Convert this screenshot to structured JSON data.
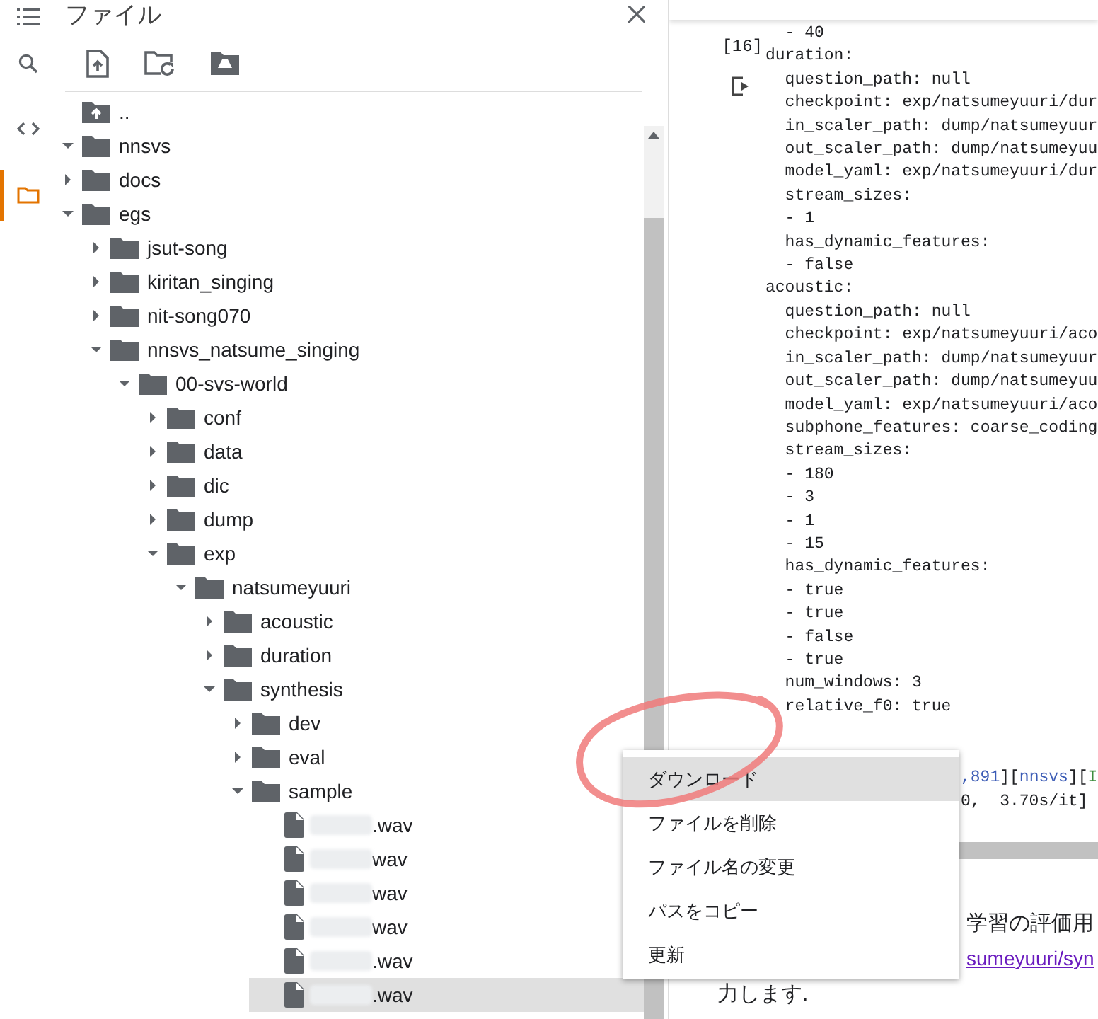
{
  "rail": [
    {
      "kind": "menu",
      "selected": false
    },
    {
      "kind": "search",
      "selected": false
    },
    {
      "kind": "code",
      "selected": false
    },
    {
      "kind": "folder",
      "selected": true
    }
  ],
  "panel": {
    "title": "ファイル",
    "toolbar": [
      {
        "kind": "upload"
      },
      {
        "kind": "refresh"
      },
      {
        "kind": "drive"
      }
    ]
  },
  "tree": [
    {
      "kind": "up",
      "name": "..",
      "selected": false
    },
    {
      "kind": "folder",
      "name": "nnsvs",
      "expanded": true,
      "selected": false,
      "children": [
        {
          "kind": "folder",
          "name": "docs",
          "expanded": false,
          "selected": false
        },
        {
          "kind": "folder",
          "name": "egs",
          "expanded": true,
          "selected": false,
          "children": [
            {
              "kind": "folder",
              "name": "jsut-song",
              "expanded": false,
              "selected": false
            },
            {
              "kind": "folder",
              "name": "kiritan_singing",
              "expanded": false,
              "selected": false
            },
            {
              "kind": "folder",
              "name": "nit-song070",
              "expanded": false,
              "selected": false
            },
            {
              "kind": "folder",
              "name": "nnsvs_natsume_singing",
              "expanded": true,
              "selected": false,
              "children": [
                {
                  "kind": "folder",
                  "name": "00-svs-world",
                  "expanded": true,
                  "selected": false,
                  "children": [
                    {
                      "kind": "folder",
                      "name": "conf",
                      "expanded": false,
                      "selected": false
                    },
                    {
                      "kind": "folder",
                      "name": "data",
                      "expanded": false,
                      "selected": false
                    },
                    {
                      "kind": "folder",
                      "name": "dic",
                      "expanded": false,
                      "selected": false
                    },
                    {
                      "kind": "folder",
                      "name": "dump",
                      "expanded": false,
                      "selected": false
                    },
                    {
                      "kind": "folder",
                      "name": "exp",
                      "expanded": true,
                      "selected": false,
                      "children": [
                        {
                          "kind": "folder",
                          "name": "natsumeyuuri",
                          "expanded": true,
                          "selected": false,
                          "children": [
                            {
                              "kind": "folder",
                              "name": "acoustic",
                              "expanded": false,
                              "selected": false
                            },
                            {
                              "kind": "folder",
                              "name": "duration",
                              "expanded": false,
                              "selected": false
                            },
                            {
                              "kind": "folder",
                              "name": "synthesis",
                              "expanded": true,
                              "selected": false,
                              "children": [
                                {
                                  "kind": "folder",
                                  "name": "dev",
                                  "expanded": false,
                                  "selected": false
                                },
                                {
                                  "kind": "folder",
                                  "name": "eval",
                                  "expanded": false,
                                  "selected": false
                                },
                                {
                                  "kind": "folder",
                                  "name": "sample",
                                  "expanded": true,
                                  "selected": false,
                                  "children": [
                                    {
                                      "kind": "file",
                                      "name": ".wav",
                                      "redacted": true,
                                      "selected": false
                                    },
                                    {
                                      "kind": "file",
                                      "name": "wav",
                                      "redacted": true,
                                      "selected": false
                                    },
                                    {
                                      "kind": "file",
                                      "name": "wav",
                                      "redacted": true,
                                      "selected": false
                                    },
                                    {
                                      "kind": "file",
                                      "name": "wav",
                                      "redacted": true,
                                      "selected": false
                                    },
                                    {
                                      "kind": "file",
                                      "name": ".wav",
                                      "redacted": true,
                                      "selected": false
                                    },
                                    {
                                      "kind": "file",
                                      "name": ".wav",
                                      "redacted": true,
                                      "selected": true
                                    }
                                  ]
                                }
                              ]
                            }
                          ]
                        }
                      ]
                    }
                  ]
                }
              ]
            }
          ]
        }
      ]
    }
  ],
  "cell": {
    "execution_count": "[16]",
    "code_lines": [
      "  - 40",
      "duration:",
      "  question_path: null",
      "  checkpoint: exp/natsumeyuuri/dur",
      "  in_scaler_path: dump/natsumeyuur",
      "  out_scaler_path: dump/natsumeyuu",
      "  model_yaml: exp/natsumeyuuri/dur",
      "  stream_sizes:",
      "  - 1",
      "  has_dynamic_features:",
      "  - false",
      "acoustic:",
      "  question_path: null",
      "  checkpoint: exp/natsumeyuuri/aco",
      "  in_scaler_path: dump/natsumeyuur",
      "  out_scaler_path: dump/natsumeyuu",
      "  model_yaml: exp/natsumeyuuri/aco",
      "  subphone_features: coarse_coding",
      "  stream_sizes:",
      "  - 180",
      "  - 3",
      "  - 1",
      "  - 15",
      "  has_dynamic_features:",
      "  - true",
      "  - true",
      "  - false",
      "  - true",
      "  num_windows: 3",
      "  relative_f0: true"
    ],
    "output_lines": [
      [
        {
          "text": ",891",
          "color": "#3b5bb5"
        },
        {
          "text": "][",
          "color": "#202124"
        },
        {
          "text": "nnsvs",
          "color": "#3b5bb5"
        },
        {
          "text": "][",
          "color": "#202124"
        },
        {
          "text": "I",
          "color": "#3c8c3c"
        }
      ],
      [
        {
          "text": "0,  3.70s/it]",
          "color": "#202124"
        }
      ]
    ]
  },
  "text_cell": [
    {
      "kind": "tail",
      "text": "学習の評価用"
    },
    {
      "kind": "link",
      "text": "sumeyuuri/syn"
    },
    {
      "kind": "line",
      "text": "力します."
    }
  ],
  "context_menu": [
    {
      "label": "ダウンロード",
      "selected": true
    },
    {
      "label": "ファイルを削除",
      "selected": false
    },
    {
      "label": "ファイル名の変更",
      "selected": false
    },
    {
      "label": "パスをコピー",
      "selected": false
    },
    {
      "label": "更新",
      "selected": false
    }
  ]
}
